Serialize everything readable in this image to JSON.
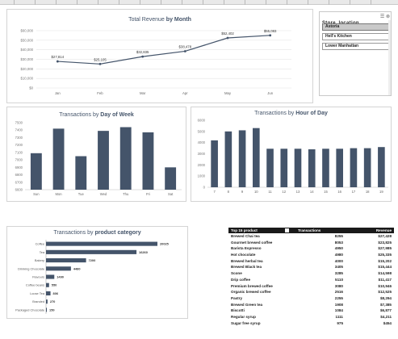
{
  "revenue_chart": {
    "title_plain": "Total Revenue",
    "title_bold": "by Month",
    "chart_data": {
      "type": "line",
      "categories": [
        "Jan",
        "Feb",
        "Mar",
        "Apr",
        "May",
        "Jun"
      ],
      "values": [
        27814,
        25105,
        32835,
        38478,
        52402,
        55083
      ],
      "data_labels": [
        "$27,814",
        "$25,105",
        "$32,835",
        "$38,478",
        "$52,402",
        "$55,083"
      ],
      "ylim": [
        0,
        60000
      ],
      "y_ticks": [
        "$0",
        "$10,000",
        "$20,000",
        "$30,000",
        "$40,000",
        "$50,000",
        "$60,000"
      ],
      "grid": true,
      "color": "#44546a"
    }
  },
  "dow_chart": {
    "title_plain": "Transactions by",
    "title_bold": "Day of Week",
    "chart_data": {
      "type": "bar",
      "categories": [
        "Sun",
        "Mon",
        "Tue",
        "Wed",
        "Thu",
        "Fri",
        "Sat"
      ],
      "values": [
        7090,
        7420,
        7050,
        7390,
        7440,
        7370,
        6900
      ],
      "ylim": [
        6600,
        7500
      ],
      "y_ticks": [
        "6600",
        "6700",
        "6800",
        "6900",
        "7000",
        "7100",
        "7200",
        "7300",
        "7400",
        "7500"
      ],
      "color": "#44546a"
    }
  },
  "hour_chart": {
    "title_plain": "Transactions by",
    "title_bold": "Hour of Day",
    "chart_data": {
      "type": "bar",
      "categories": [
        "7",
        "8",
        "9",
        "10",
        "11",
        "12",
        "13",
        "14",
        "15",
        "16",
        "17",
        "18",
        "19"
      ],
      "values": [
        4200,
        5000,
        5100,
        5300,
        3450,
        3450,
        3450,
        3400,
        3450,
        3450,
        3500,
        3500,
        3600
      ],
      "ylim": [
        0,
        6000
      ],
      "y_ticks": [
        "0",
        "1000",
        "2000",
        "3000",
        "4000",
        "5000",
        "6000"
      ],
      "color": "#44546a"
    }
  },
  "category_chart": {
    "title_plain": "Transactions by",
    "title_bold": "product category",
    "chart_data": {
      "type": "bar",
      "orientation": "horizontal",
      "categories": [
        "Coffee",
        "Tea",
        "Bakery",
        "Drinking Chocolate",
        "Flavours",
        "Coffee beans",
        "Loose Tea",
        "Branded",
        "Packaged Chocolate"
      ],
      "values": [
        20025,
        16260,
        7200,
        4480,
        1490,
        550,
        806,
        270,
        150
      ],
      "data_labels": [
        "20025",
        "16260",
        "7200",
        "4480",
        "1490",
        "550",
        "806",
        "270",
        "150"
      ],
      "color": "#44546a"
    }
  },
  "slicer": {
    "title": "Store_location",
    "items": [
      {
        "label": "Astoria",
        "selected": true
      },
      {
        "label": "Hell's Kitchen",
        "selected": false
      },
      {
        "label": "Lower Manhattan",
        "selected": false
      }
    ]
  },
  "top_products": {
    "headers": [
      "Top 15 product",
      "Transactions",
      "Revenue"
    ],
    "rows": [
      [
        "Brewed Chai tea",
        "8255",
        "$27,428"
      ],
      [
        "Gourmet brewed coffee",
        "8053",
        "$23,825"
      ],
      [
        "Barista Espresso",
        "4950",
        "$27,985"
      ],
      [
        "Hot chocolate",
        "4980",
        "$25,335"
      ],
      [
        "Brewed herbal tea",
        "4000",
        "$15,202"
      ],
      [
        "Brewed Black tea",
        "3405",
        "$15,444"
      ],
      [
        "Scone",
        "3285",
        "$14,598"
      ],
      [
        "Drip coffee",
        "5110",
        "$11,417"
      ],
      [
        "Premium brewed coffee",
        "3080",
        "$10,946"
      ],
      [
        "Organic brewed coffee",
        "2516",
        "$12,525"
      ],
      [
        "Pastry",
        "2255",
        "$8,294"
      ],
      [
        "Brewed Green tea",
        "1908",
        "$7,385"
      ],
      [
        "Biscotti",
        "1084",
        "$6,877"
      ],
      [
        "Regular syrup",
        "1111",
        "$4,211"
      ],
      [
        "Sugar free syrup",
        "975",
        "$454"
      ]
    ]
  }
}
